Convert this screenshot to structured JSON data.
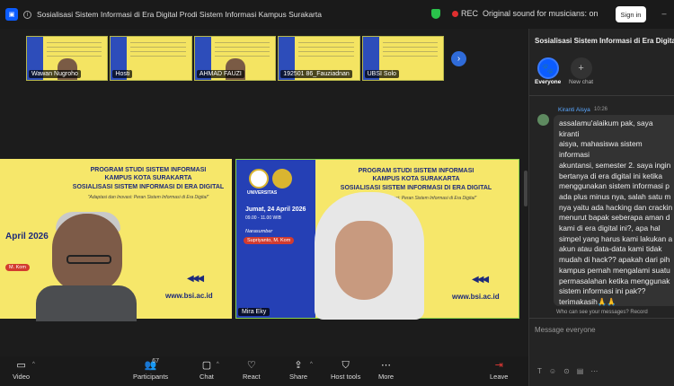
{
  "window": {
    "title": "Sosialisasi Sistem Informasi di Era Digital Prodi Sistem Informasi Kampus Surakarta",
    "rec_label": "REC",
    "original_sound": "Original sound for musicians: on",
    "signin_label": "Sign in"
  },
  "thumbnails": [
    {
      "name": "Wawan Nugroho"
    },
    {
      "name": "Hosti"
    },
    {
      "name": "AHMAD FAUZI"
    },
    {
      "name": "192501 86_Fauziadnan"
    },
    {
      "name": "UBSI Solo"
    }
  ],
  "slide": {
    "prog": "PROGRAM STUDI SISTEM INFORMASI",
    "kampus": "KAMPUS KOTA SURAKARTA",
    "sos": "SOSIALISASI SISTEM INFORMASI DI ERA DIGITAL",
    "sub": "\"Adaptasi dan Inovasi: Peran Sistem Informasi di Era Digital\"",
    "url": "www.bsi.ac.id",
    "date_left": "April 2026",
    "date_right": "Jumat, 24 April 2026",
    "time": "09.00 - 11.00 WIB",
    "narasumber": "Narasumber",
    "speaker": "Supriyanto, M. Kom",
    "left_pill": "M. Kom",
    "univ": "UNIVERSITAS"
  },
  "video_names": {
    "right": "Mira Eky"
  },
  "toolbar": {
    "video": "Video",
    "participants": "Participants",
    "participants_count": "67",
    "chat": "Chat",
    "react": "React",
    "share": "Share",
    "host_tools": "Host tools",
    "more": "More",
    "leave": "Leave"
  },
  "chat": {
    "header": "Sosialisasi Sistem Informasi di Era Digital Pro",
    "everyone": "Everyone",
    "new_chat": "New chat",
    "sender": "Kiranti Aisya",
    "time": "10:26",
    "message": "assalamu'alaikum pak, saya kiranti\naisya, mahasiswa sistem informasi\nakuntansi, semester 2. saya ingin\nbertanya di era digital ini ketika\nmenggunakan sistem informasi p\nada plus minus nya, salah satu m\nnya yaitu ada hacking dan crackin\nmenurut bapak seberapa aman d\nkami di era digital ini?, apa hal\nsimpel yang harus kami lakukan a\nakun atau data-data kami tidak\nmudah di hack?? apakah dari pih\nkampus pernah mengalami suatu\npermasalahan ketika menggunak\nsistem informasi ini pak??\nterimakasih🙏🙏",
    "privacy": "Who can see your messages? Record",
    "placeholder": "Message everyone"
  }
}
